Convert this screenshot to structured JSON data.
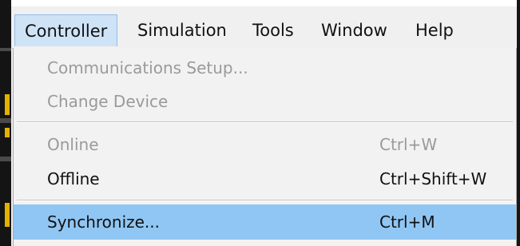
{
  "menubar": {
    "items": [
      {
        "label": "Controller",
        "active": true
      },
      {
        "label": "Simulation"
      },
      {
        "label": "Tools"
      },
      {
        "label": "Window"
      },
      {
        "label": "Help"
      }
    ]
  },
  "dropdown": {
    "items": [
      {
        "label": "Communications Setup...",
        "shortcut": "",
        "enabled": false
      },
      {
        "label": "Change Device",
        "shortcut": "",
        "enabled": false
      },
      {
        "label": "Online",
        "shortcut": "Ctrl+W",
        "enabled": false
      },
      {
        "label": "Offline",
        "shortcut": "Ctrl+Shift+W",
        "enabled": true
      },
      {
        "label": "Synchronize...",
        "shortcut": "Ctrl+M",
        "enabled": true,
        "highlighted": true
      }
    ]
  },
  "colors": {
    "menu_background": "#f0f0f0",
    "active_menubar_item": "#cfe3f7",
    "highlight": "#90c6f3",
    "disabled_text": "#9a9a9a",
    "text": "#111111"
  }
}
